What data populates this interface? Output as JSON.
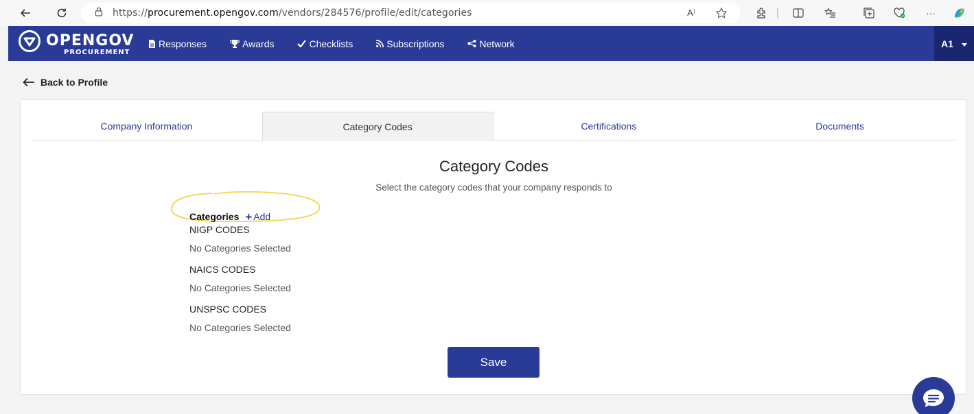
{
  "browser": {
    "url_prefix": "https://",
    "url_host": "procurement.opengov.com",
    "url_path": "/vendors/284576/profile/edit/categories",
    "read_aloud_label": "A⁾"
  },
  "app": {
    "logo_title": "OPENGOV",
    "logo_subtitle": "PROCUREMENT",
    "nav_items": [
      {
        "label": "Responses",
        "icon": "document-icon"
      },
      {
        "label": "Awards",
        "icon": "trophy-icon"
      },
      {
        "label": "Checklists",
        "icon": "check-icon"
      },
      {
        "label": "Subscriptions",
        "icon": "rss-icon"
      },
      {
        "label": "Network",
        "icon": "share-icon"
      }
    ],
    "user_initials": "A1"
  },
  "back_link": "Back to Profile",
  "tabs": [
    {
      "label": "Company Information",
      "active": false
    },
    {
      "label": "Category Codes",
      "active": true
    },
    {
      "label": "Certifications",
      "active": false
    },
    {
      "label": "Documents",
      "active": false
    }
  ],
  "section": {
    "title": "Category Codes",
    "subtitle": "Select the category codes that your company responds to"
  },
  "categories": {
    "label": "Categories",
    "add_label": "Add",
    "groups": [
      {
        "title": "NIGP CODES",
        "empty": "No Categories Selected"
      },
      {
        "title": "NAICS CODES",
        "empty": "No Categories Selected"
      },
      {
        "title": "UNSPSC CODES",
        "empty": "No Categories Selected"
      }
    ]
  },
  "save_label": "Save",
  "colors": {
    "brand": "#2a3a97",
    "user_menu_bg": "#1a2770",
    "highlight": "#f5d24a"
  }
}
